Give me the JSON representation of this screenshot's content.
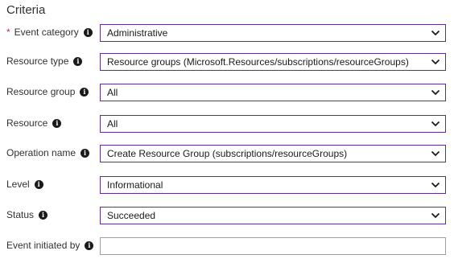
{
  "section": {
    "title": "Criteria"
  },
  "fields": {
    "event_category": {
      "label": "Event category",
      "required_mark": "*",
      "value": "Administrative"
    },
    "resource_type": {
      "label": "Resource type",
      "value": "Resource groups (Microsoft.Resources/subscriptions/resourceGroups)"
    },
    "resource_group": {
      "label": "Resource group",
      "value": "All"
    },
    "resource": {
      "label": "Resource",
      "value": "All"
    },
    "operation_name": {
      "label": "Operation name",
      "value": "Create Resource Group (subscriptions/resourceGroups)"
    },
    "level": {
      "label": "Level",
      "value": "Informational"
    },
    "status": {
      "label": "Status",
      "value": "Succeeded"
    },
    "event_initiated_by": {
      "label": "Event initiated by",
      "value": "",
      "placeholder": ""
    }
  },
  "icons": {
    "info": "info-icon",
    "dropdown": "chevron-down-icon"
  },
  "colors": {
    "accent_border": "#5c2d91",
    "required": "#c4314b",
    "input_border": "#a19f9d"
  }
}
